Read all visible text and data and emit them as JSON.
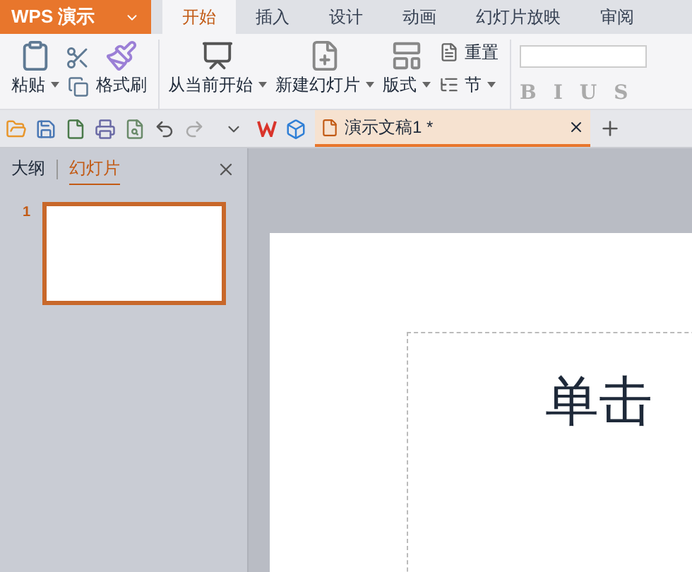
{
  "app_menu": {
    "label": "WPS 演示"
  },
  "tabs": [
    {
      "label": "开始",
      "selected": true
    },
    {
      "label": "插入",
      "selected": false
    },
    {
      "label": "设计",
      "selected": false
    },
    {
      "label": "动画",
      "selected": false
    },
    {
      "label": "幻灯片放映",
      "selected": false
    },
    {
      "label": "审阅",
      "selected": false
    }
  ],
  "ribbon": {
    "paste": "粘贴",
    "format_painter": "格式刷",
    "from_current": "从当前开始",
    "new_slide": "新建幻灯片",
    "layout": "版式",
    "reset": "重置",
    "section": "节",
    "font_styles": [
      "B",
      "I",
      "U",
      "S"
    ]
  },
  "document_tab": {
    "title": "演示文稿1 *",
    "selected": true
  },
  "panel": {
    "tabs": [
      {
        "label": "大纲",
        "selected": false
      },
      {
        "label": "幻灯片",
        "selected": true
      }
    ],
    "slides": [
      {
        "number": "1",
        "selected": true
      }
    ]
  },
  "slide": {
    "placeholder": "单击"
  }
}
